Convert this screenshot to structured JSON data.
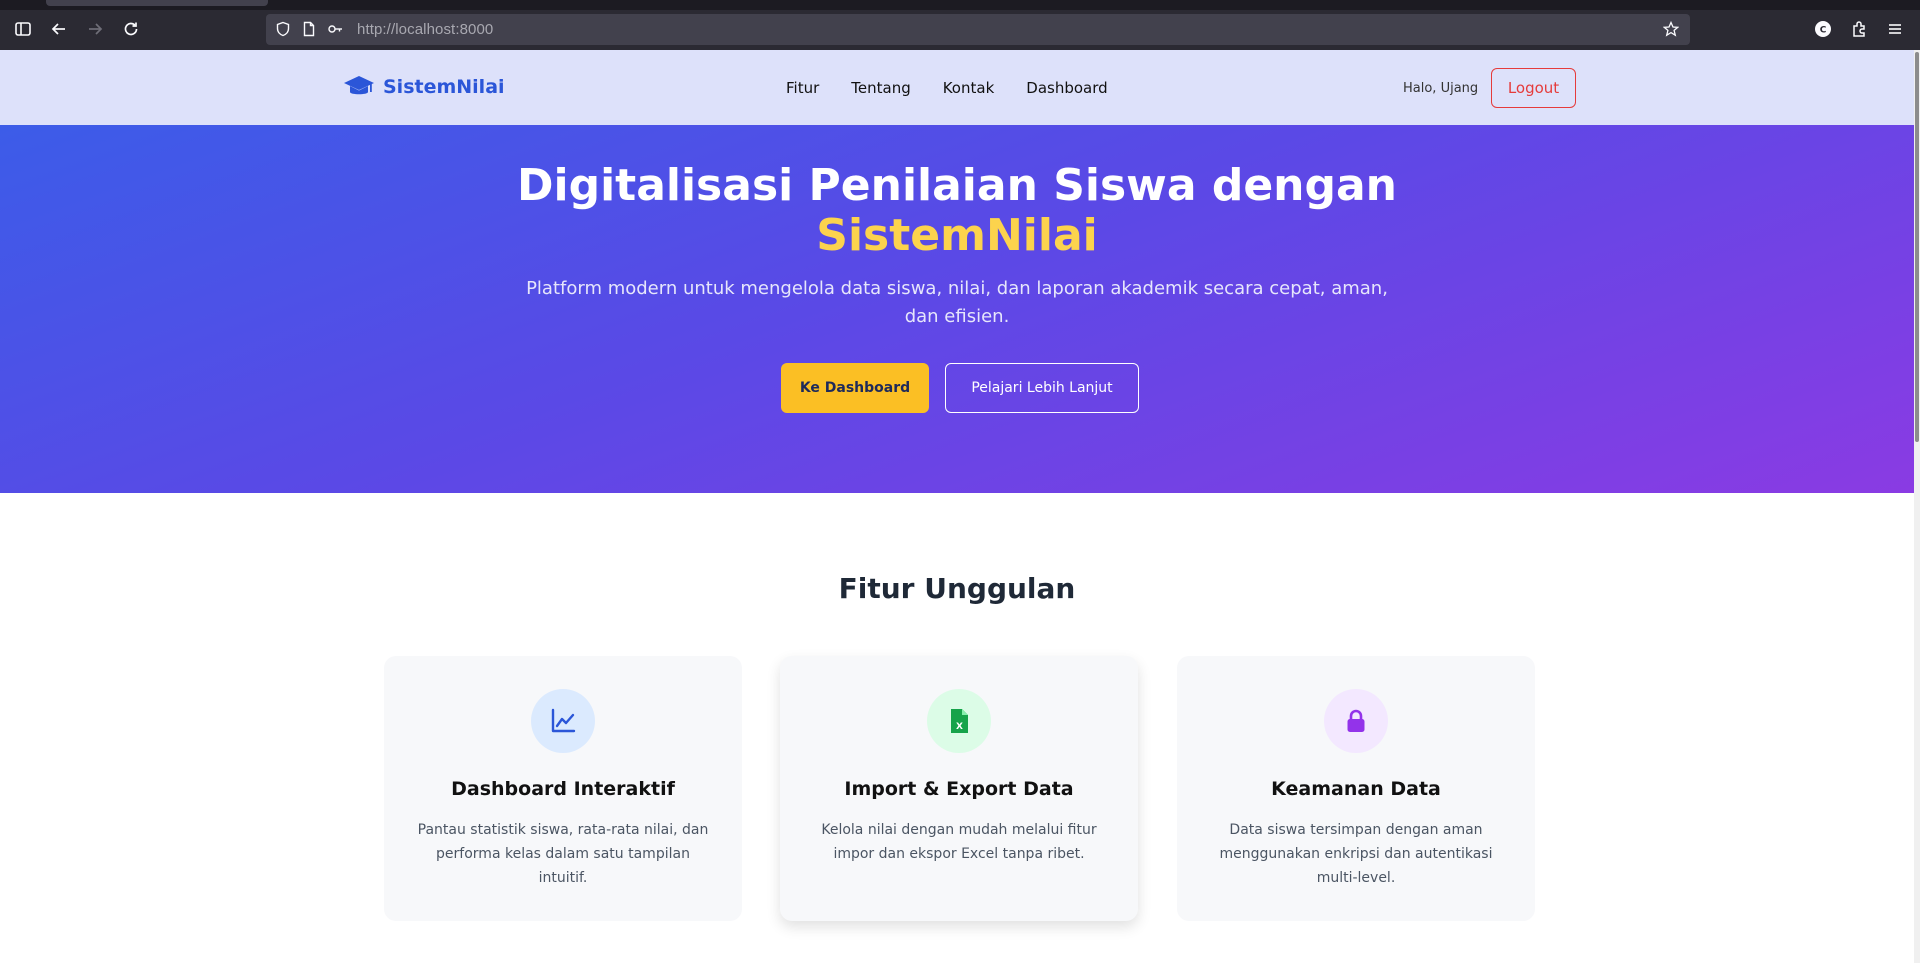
{
  "browser": {
    "url_host": "http://localhost",
    "url_port": ":8000"
  },
  "navbar": {
    "brand": "SistemNilai",
    "links": [
      "Fitur",
      "Tentang",
      "Kontak",
      "Dashboard"
    ],
    "greeting": "Halo, Ujang",
    "logout_label": "Logout"
  },
  "hero": {
    "title_line1": "Digitalisasi Penilaian Siswa dengan",
    "title_highlight": "SistemNilai",
    "subtitle": "Platform modern untuk mengelola data siswa, nilai, dan laporan akademik secara cepat, aman, dan efisien.",
    "primary_button": "Ke Dashboard",
    "secondary_button": "Pelajari Lebih Lanjut"
  },
  "features": {
    "title": "Fitur Unggulan",
    "cards": [
      {
        "icon": "chart-line-icon",
        "title": "Dashboard Interaktif",
        "desc": "Pantau statistik siswa, rata-rata nilai, dan performa kelas dalam satu tampilan intuitif.",
        "icon_bg": "#dbeafe",
        "icon_color": "#2b56d8"
      },
      {
        "icon": "excel-file-icon",
        "title": "Import & Export Data",
        "desc": "Kelola nilai dengan mudah melalui fitur impor dan ekspor Excel tanpa ribet.",
        "icon_bg": "#dcfce7",
        "icon_color": "#16a34a"
      },
      {
        "icon": "lock-icon",
        "title": "Keamanan Data",
        "desc": "Data siswa tersimpan dengan aman menggunakan enkripsi dan autentikasi multi-level.",
        "icon_bg": "#f3e8ff",
        "icon_color": "#9333ea"
      }
    ]
  },
  "colors": {
    "brand": "#2b56d8",
    "accent": "#fcd34d",
    "button_primary": "#fbbf24",
    "logout": "#e53b3b"
  }
}
